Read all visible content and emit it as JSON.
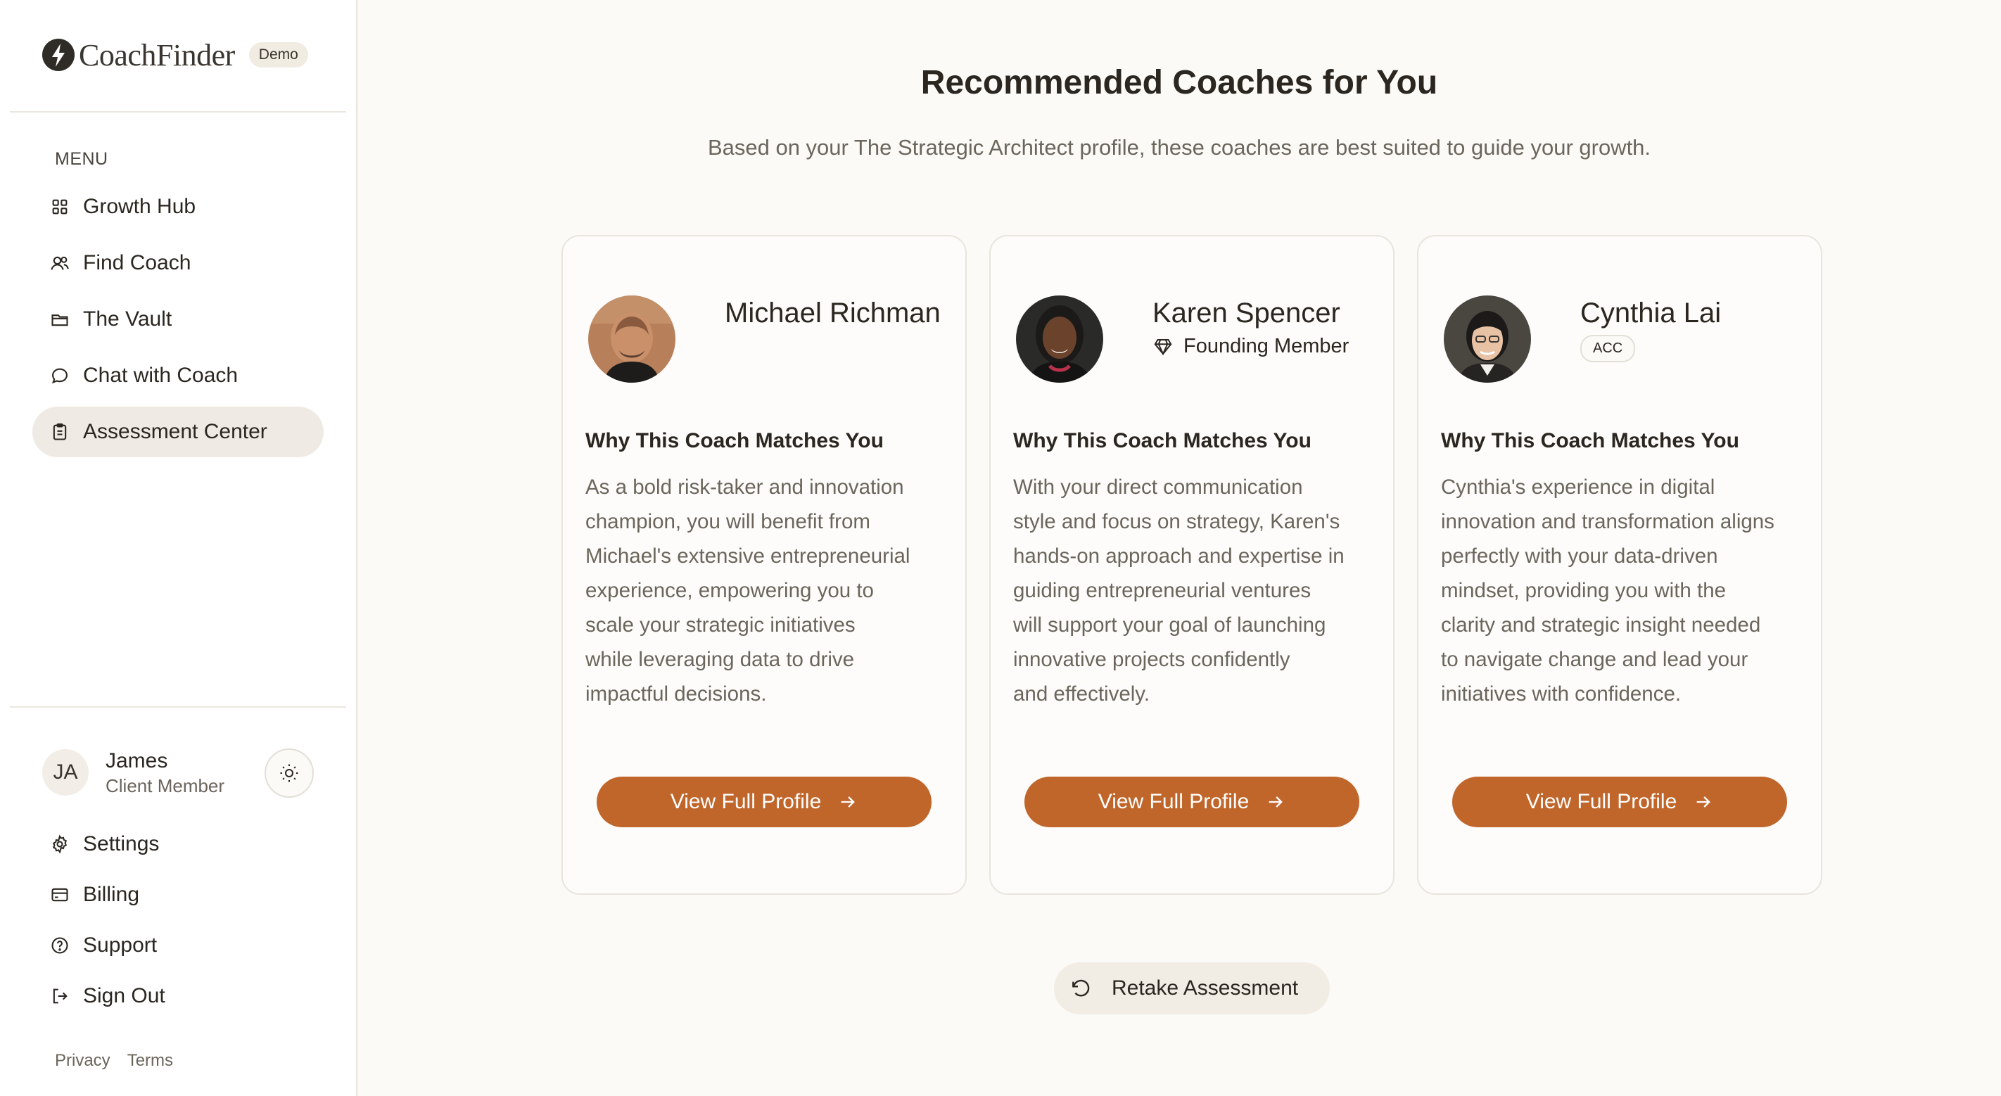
{
  "app": {
    "name": "CoachFinder",
    "badge": "Demo"
  },
  "sidebar": {
    "menu_label": "MENU",
    "items": [
      {
        "label": "Growth Hub",
        "icon": "grid-icon",
        "active": false
      },
      {
        "label": "Find Coach",
        "icon": "users-icon",
        "active": false
      },
      {
        "label": "The Vault",
        "icon": "folder-icon",
        "active": false
      },
      {
        "label": "Chat with Coach",
        "icon": "chat-icon",
        "active": false
      },
      {
        "label": "Assessment Center",
        "icon": "clipboard-icon",
        "active": true
      }
    ],
    "user": {
      "initials": "JA",
      "name": "James",
      "role": "Client Member"
    },
    "footer_items": [
      {
        "label": "Settings",
        "icon": "gear-icon"
      },
      {
        "label": "Billing",
        "icon": "credit-card-icon"
      },
      {
        "label": "Support",
        "icon": "help-circle-icon"
      },
      {
        "label": "Sign Out",
        "icon": "sign-out-icon"
      }
    ],
    "legal": {
      "privacy": "Privacy",
      "terms": "Terms"
    }
  },
  "main": {
    "title": "Recommended Coaches for You",
    "subtitle": "Based on your The Strategic Architect profile, these coaches are best suited to guide your growth.",
    "coaches": [
      {
        "name": "Michael Richman",
        "tag": "",
        "why_title": "Why This Coach Matches You",
        "why_lines": [
          "As a bold risk-taker and innovation",
          "champion, you will benefit from",
          "Michael's extensive entrepreneurial",
          "experience, empowering you to",
          "scale your strategic initiatives",
          "while leveraging data to drive",
          "impactful decisions."
        ],
        "cta": "View Full Profile"
      },
      {
        "name": "Karen Spencer",
        "tag": "Founding Member",
        "why_title": "Why This Coach Matches You",
        "why_lines": [
          "With your direct communication",
          "style and focus on strategy, Karen's",
          "hands-on approach and expertise in",
          "guiding entrepreneurial ventures",
          "will support your goal of launching",
          "innovative projects confidently",
          "and effectively."
        ],
        "cta": "View Full Profile"
      },
      {
        "name": "Cynthia Lai",
        "tag": "ACC",
        "why_title": "Why This Coach Matches You",
        "why_lines": [
          "Cynthia's experience in digital",
          "innovation and transformation aligns",
          "perfectly with your data-driven",
          "mindset, providing you with the",
          "clarity and strategic insight needed",
          "to navigate change and lead your",
          "initiatives with confidence."
        ],
        "cta": "View Full Profile"
      }
    ],
    "retake_label": "Retake Assessment"
  },
  "colors": {
    "accent": "#c0662b",
    "active_nav": "#efebe4",
    "text": "#2b2620",
    "muted": "#6b655c"
  }
}
